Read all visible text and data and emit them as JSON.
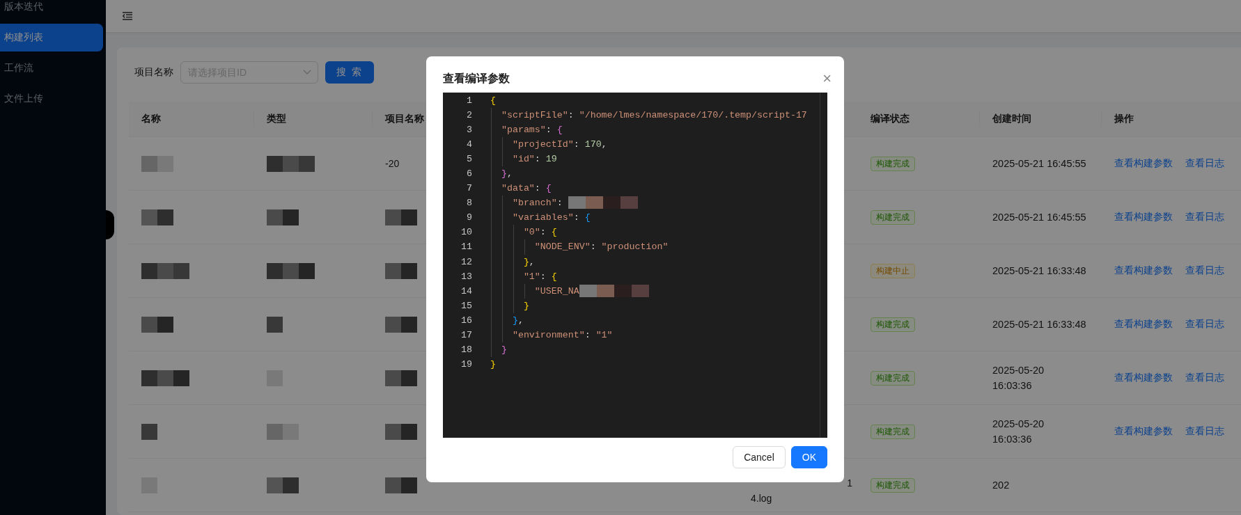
{
  "sidebar": {
    "items": [
      {
        "label": "版本迭代",
        "selected": false
      },
      {
        "label": "构建列表",
        "selected": true
      },
      {
        "label": "工作流",
        "selected": false
      },
      {
        "label": "文件上传",
        "selected": false
      }
    ]
  },
  "search": {
    "label": "项目名称",
    "placeholder": "请选择项目ID",
    "button": "搜 索"
  },
  "table": {
    "columns": [
      "名称",
      "类型",
      "项目名称",
      "编译状态",
      "创建时间",
      "操作"
    ],
    "rows": [
      {
        "project": "-20",
        "status": {
          "label": "构建完成",
          "kind": "done"
        },
        "time": [
          "2025-05-21 16:45:55"
        ],
        "actions": [
          "查看构建参数",
          "查看日志"
        ]
      },
      {
        "status": {
          "label": "构建完成",
          "kind": "done"
        },
        "time": [
          "2025-05-21 16:45:55"
        ],
        "actions": [
          "查看构建参数",
          "查看日志"
        ]
      },
      {
        "status": {
          "label": "构建中止",
          "kind": "stopped"
        },
        "time": [
          "2025-05-21 16:33:48"
        ],
        "actions": [
          "查看构建参数",
          "查看日志"
        ]
      },
      {
        "status": {
          "label": "构建完成",
          "kind": "done"
        },
        "time": [
          "2025-05-21 16:33:48"
        ],
        "actions": [
          "查看构建参数",
          "查看日志"
        ]
      },
      {
        "status": {
          "label": "构建完成",
          "kind": "done"
        },
        "time": [
          "2025-05-20",
          "16:03:36"
        ],
        "actions": [
          "查看构建参数",
          "查看日志"
        ]
      },
      {
        "status": {
          "label": "构建完成",
          "kind": "done"
        },
        "time": [
          "2025-05-20",
          "16:03:36"
        ],
        "actions": [
          "查看构建参数",
          "查看日志"
        ]
      },
      {
        "file": [
          "1",
          "4.log"
        ],
        "status": {
          "label": "构建完成",
          "kind": "done"
        },
        "time": [
          "202"
        ],
        "actions": []
      }
    ]
  },
  "modal": {
    "title": "查看编译参数",
    "close": "×",
    "code": [
      {
        "number": "1",
        "tokens": [
          {
            "kind": "brace",
            "text": "{",
            "color": "#ffd700"
          }
        ]
      },
      {
        "number": "2",
        "tokens": [
          {
            "kind": "key",
            "text": "  \"scriptFile\""
          },
          {
            "kind": "punct",
            "text": ": "
          },
          {
            "kind": "str",
            "text": "\"/home/lmes/namespace/170/.temp/script-17"
          }
        ]
      },
      {
        "number": "3",
        "tokens": [
          {
            "kind": "key",
            "text": "  \"params\""
          },
          {
            "kind": "punct",
            "text": ": "
          },
          {
            "kind": "brace",
            "text": "{",
            "color": "#da70d6"
          }
        ]
      },
      {
        "number": "4",
        "tokens": [
          {
            "kind": "key",
            "text": "    \"projectId\""
          },
          {
            "kind": "punct",
            "text": ": "
          },
          {
            "kind": "num",
            "text": "170"
          },
          {
            "kind": "punct",
            "text": ","
          }
        ]
      },
      {
        "number": "5",
        "tokens": [
          {
            "kind": "key",
            "text": "    \"id\""
          },
          {
            "kind": "punct",
            "text": ": "
          },
          {
            "kind": "num",
            "text": "19"
          }
        ]
      },
      {
        "number": "6",
        "tokens": [
          {
            "kind": "brace",
            "text": "  }",
            "color": "#da70d6"
          },
          {
            "kind": "punct",
            "text": ","
          }
        ]
      },
      {
        "number": "7",
        "tokens": [
          {
            "kind": "key",
            "text": "  \"data\""
          },
          {
            "kind": "punct",
            "text": ": "
          },
          {
            "kind": "brace",
            "text": "{",
            "color": "#da70d6"
          }
        ]
      },
      {
        "number": "8",
        "tokens": [
          {
            "kind": "key",
            "text": "    \"branch\""
          },
          {
            "kind": "punct",
            "text": ": "
          },
          {
            "kind": "redacted"
          }
        ]
      },
      {
        "number": "9",
        "tokens": [
          {
            "kind": "key",
            "text": "    \"variables\""
          },
          {
            "kind": "punct",
            "text": ": "
          },
          {
            "kind": "brace",
            "text": "{",
            "color": "#179fff"
          }
        ]
      },
      {
        "number": "10",
        "tokens": [
          {
            "kind": "key",
            "text": "      \"0\""
          },
          {
            "kind": "punct",
            "text": ": "
          },
          {
            "kind": "brace",
            "text": "{",
            "color": "#ffd700"
          }
        ]
      },
      {
        "number": "11",
        "tokens": [
          {
            "kind": "key",
            "text": "        \"NODE_ENV\""
          },
          {
            "kind": "punct",
            "text": ": "
          },
          {
            "kind": "str",
            "text": "\"production\""
          }
        ]
      },
      {
        "number": "12",
        "tokens": [
          {
            "kind": "brace",
            "text": "      }",
            "color": "#ffd700"
          },
          {
            "kind": "punct",
            "text": ","
          }
        ]
      },
      {
        "number": "13",
        "tokens": [
          {
            "kind": "key",
            "text": "      \"1\""
          },
          {
            "kind": "punct",
            "text": ": "
          },
          {
            "kind": "brace",
            "text": "{",
            "color": "#ffd700"
          }
        ]
      },
      {
        "number": "14",
        "tokens": [
          {
            "kind": "key",
            "text": "        \"USER_NA"
          },
          {
            "kind": "redacted"
          }
        ]
      },
      {
        "number": "15",
        "tokens": [
          {
            "kind": "brace",
            "text": "      }",
            "color": "#ffd700"
          }
        ]
      },
      {
        "number": "16",
        "tokens": [
          {
            "kind": "brace",
            "text": "    }",
            "color": "#179fff"
          },
          {
            "kind": "punct",
            "text": ","
          }
        ]
      },
      {
        "number": "17",
        "tokens": [
          {
            "kind": "key",
            "text": "    \"environment\""
          },
          {
            "kind": "punct",
            "text": ": "
          },
          {
            "kind": "str",
            "text": "\"1\""
          }
        ]
      },
      {
        "number": "18",
        "tokens": [
          {
            "kind": "brace",
            "text": "  }",
            "color": "#da70d6"
          }
        ]
      },
      {
        "number": "19",
        "tokens": [
          {
            "kind": "brace",
            "text": "}",
            "color": "#ffd700"
          }
        ]
      }
    ],
    "buttons": [
      {
        "label": "Cancel",
        "kind": "default"
      },
      {
        "label": "OK",
        "kind": "primary"
      }
    ]
  }
}
